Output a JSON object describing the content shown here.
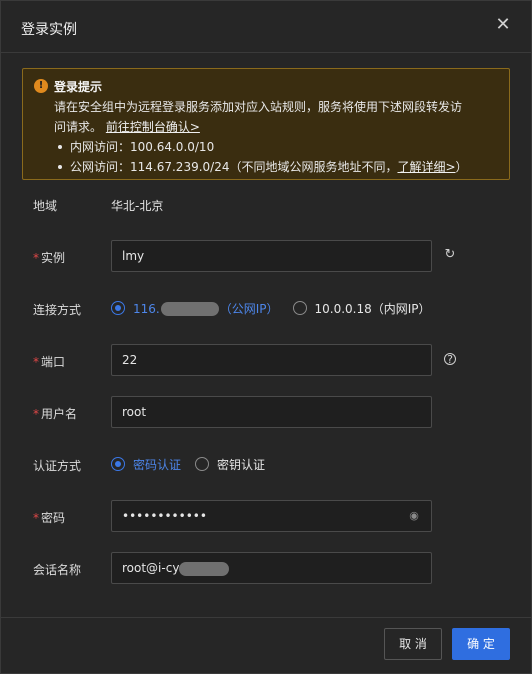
{
  "dialog": {
    "title": "登录实例",
    "close_icon": "close-icon"
  },
  "notice": {
    "icon": "warning-icon",
    "title": "登录提示",
    "line1": "请在安全组中为远程登录服务添加对应入站规则，服务将使用下述网段转发访",
    "line2_prefix": "问请求。",
    "line2_link": "前往控制台确认>",
    "bullet1": "内网访问：100.64.0.0/10",
    "bullet2_prefix": "公网访问：114.67.239.0/24（不同地域公网服务地址不同，",
    "bullet2_link": "了解详细>",
    "bullet2_suffix": "）"
  },
  "form": {
    "region": {
      "label": "地域",
      "value": "华北-北京"
    },
    "instance": {
      "label": "实例",
      "value": "lmy",
      "refresh_icon": "refresh-icon"
    },
    "connection": {
      "label": "连接方式",
      "options": [
        {
          "prefix": "116.",
          "suffix": "（公网IP）",
          "selected": true
        },
        {
          "label": "10.0.0.18（内网IP）",
          "selected": false
        }
      ]
    },
    "port": {
      "label": "端口",
      "value": "22",
      "help_icon": "help-icon"
    },
    "username": {
      "label": "用户名",
      "value": "root"
    },
    "auth": {
      "label": "认证方式",
      "options": [
        {
          "label": "密码认证",
          "selected": true
        },
        {
          "label": "密钥认证",
          "selected": false
        }
      ]
    },
    "password": {
      "label": "密码",
      "value": "••••••••••••",
      "eye_icon": "eye-icon"
    },
    "session": {
      "label": "会话名称",
      "value_prefix": "root@i-cy"
    }
  },
  "footer": {
    "cancel_label": "取 消",
    "ok_label": "确 定"
  },
  "colors": {
    "accent": "#2f6ee0",
    "warning_bg": "#3a2d10",
    "warning_border": "#8a6a1c",
    "required": "#e04848"
  }
}
